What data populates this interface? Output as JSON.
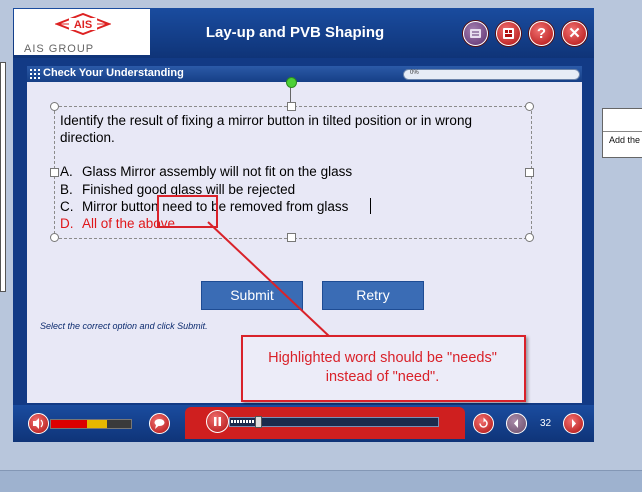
{
  "header": {
    "logo_text": "AIS",
    "logo_subtext": "AIS GROUP",
    "course_title": "Lay-up and PVB Shaping"
  },
  "section": {
    "title": "Check Your Understanding",
    "progress_label": "0%",
    "progress_value": 0
  },
  "question": {
    "prompt": "Identify the result of fixing a mirror button in tilted position or in wrong direction.",
    "options": [
      {
        "key": "A.",
        "text": "Glass Mirror assembly will not fit on the glass"
      },
      {
        "key": "B.",
        "text": "Finished good glass will be rejected"
      },
      {
        "key": "C.",
        "text": "Mirror button need to be removed from glass"
      },
      {
        "key": "D.",
        "text": "All of the above"
      }
    ]
  },
  "actions": {
    "submit_label": "Submit",
    "retry_label": "Retry"
  },
  "instruction": "Select the correct option and click Submit.",
  "review_note": {
    "text": "Highlighted word should be \"needs\" instead of \"need\"."
  },
  "footer": {
    "page_number": "32"
  },
  "side_panel": {
    "text": "Add the"
  },
  "colors": {
    "player_blue": "#123a85",
    "button_red": "#cf1f1f",
    "annotation_red": "#d9222a",
    "correct_answer_red": "#e0171a"
  },
  "icons": {
    "notes": "notes-icon",
    "glossary": "glossary-icon",
    "help": "help-icon",
    "exit": "close-icon",
    "volume": "speaker-icon",
    "captions": "speech-bubble-icon",
    "pause": "pause-icon",
    "replay": "replay-icon",
    "prev": "chevron-left-icon",
    "next": "chevron-right-icon"
  }
}
